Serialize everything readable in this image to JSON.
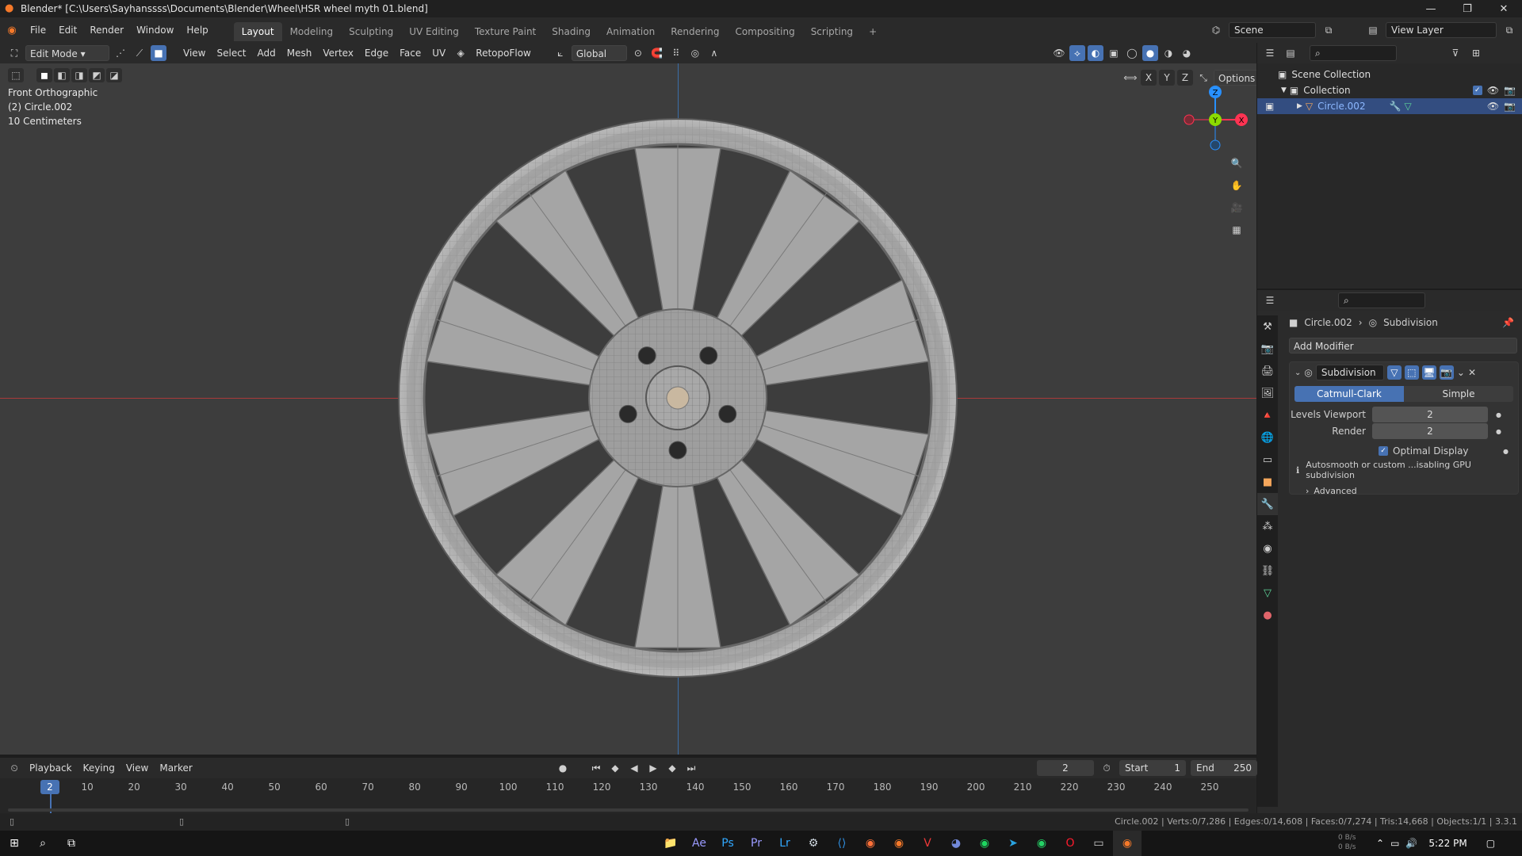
{
  "window": {
    "title": "Blender* [C:\\Users\\Sayhanssss\\Documents\\Blender\\Wheel\\HSR wheel myth 01.blend]",
    "minimize": "—",
    "maximize": "❐",
    "close": "✕"
  },
  "menubar": {
    "items": [
      "File",
      "Edit",
      "Render",
      "Window",
      "Help"
    ],
    "workspaces": [
      "Layout",
      "Modeling",
      "Sculpting",
      "UV Editing",
      "Texture Paint",
      "Shading",
      "Animation",
      "Rendering",
      "Compositing",
      "Scripting"
    ],
    "add_workspace": "+",
    "scene": "Scene",
    "view_layer": "View Layer"
  },
  "viewport_header": {
    "mode": "Edit Mode",
    "menus": [
      "View",
      "Select",
      "Add",
      "Mesh",
      "Vertex",
      "Edge",
      "Face",
      "UV"
    ],
    "retopo": "RetopoFlow",
    "orientation": "Global",
    "options": "Options",
    "axes": [
      "X",
      "Y",
      "Z"
    ]
  },
  "viewport": {
    "view_name": "Front Orthographic",
    "object_name": "(2) Circle.002",
    "scale": "10 Centimeters",
    "gizmo": {
      "z": "Z",
      "y": "Y",
      "x": "X"
    }
  },
  "outliner": {
    "scene_collection": "Scene Collection",
    "collection": "Collection",
    "object": "Circle.002"
  },
  "properties": {
    "breadcrumb_object": "Circle.002",
    "breadcrumb_modifier": "Subdivision",
    "add_modifier": "Add Modifier",
    "modifier_name": "Subdivision",
    "tab_catmull": "Catmull-Clark",
    "tab_simple": "Simple",
    "levels_viewport_label": "Levels Viewport",
    "levels_viewport_value": "2",
    "render_label": "Render",
    "render_value": "2",
    "optimal_display": "Optimal Display",
    "warning": "Autosmooth or custom ...isabling GPU subdivision",
    "advanced": "Advanced"
  },
  "timeline": {
    "menus": [
      "Playback",
      "Keying",
      "View",
      "Marker"
    ],
    "current_frame": "2",
    "start_label": "Start",
    "start_value": "1",
    "end_label": "End",
    "end_value": "250",
    "ticks": [
      "10",
      "20",
      "30",
      "40",
      "50",
      "60",
      "70",
      "80",
      "90",
      "100",
      "110",
      "120",
      "130",
      "140",
      "150",
      "160",
      "170",
      "180",
      "190",
      "200",
      "210",
      "220",
      "230",
      "240",
      "250"
    ],
    "playhead": "2"
  },
  "statusbar": {
    "stats": "Circle.002 | Verts:0/7,286 | Edges:0/14,608 | Faces:0/7,274 | Tris:14,668 | Objects:1/1 | 3.3.1"
  },
  "taskbar": {
    "time": "5:22 PM",
    "net_up": "0 B/s",
    "net_down": "0 B/s"
  },
  "colors": {
    "accent": "#4772b3",
    "x_axis": "#ff3352",
    "y_axis": "#8bdc00",
    "z_axis": "#2890ff",
    "blender_orange": "#f5792a"
  }
}
